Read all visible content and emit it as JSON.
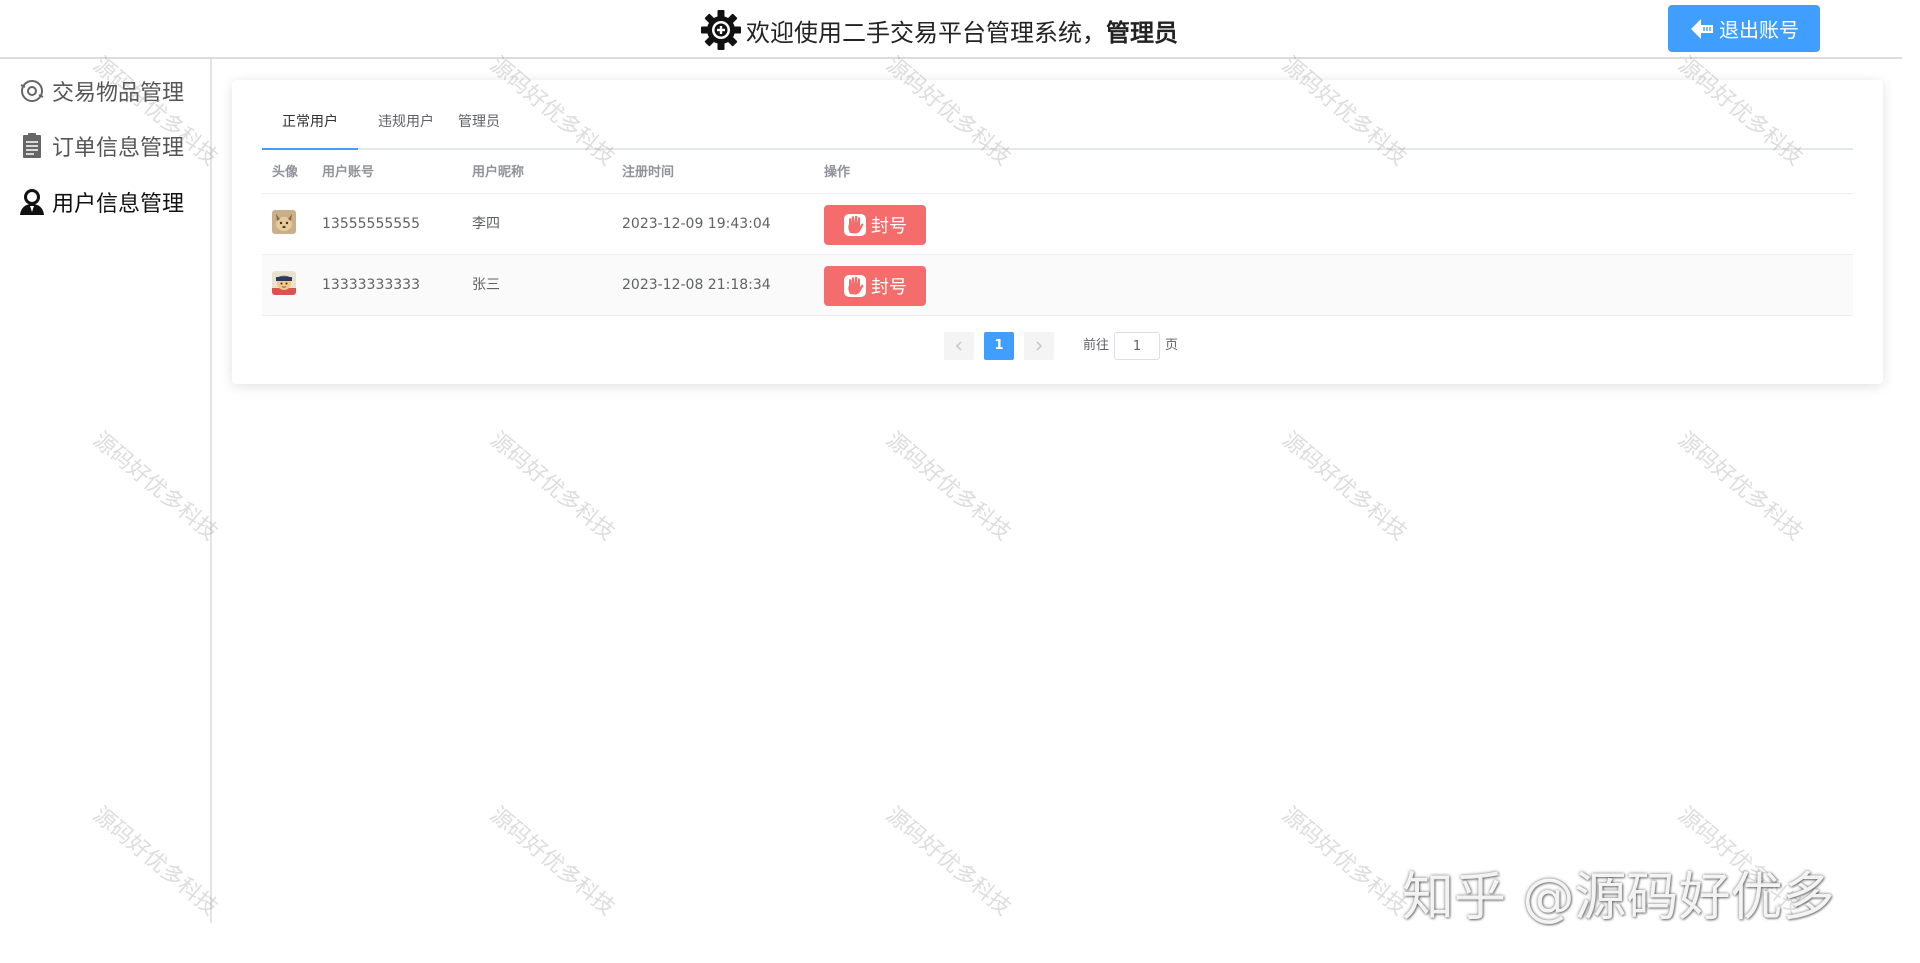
{
  "header": {
    "title": "欢迎使用二手交易平台管理系统，",
    "role": "管理员",
    "logout_label": "退出账号",
    "logout_color": "#409eff"
  },
  "sidebar": {
    "items": [
      {
        "label": "交易物品管理",
        "icon": "item-icon"
      },
      {
        "label": "订单信息管理",
        "icon": "order-icon"
      },
      {
        "label": "用户信息管理",
        "icon": "user-icon",
        "active": true
      }
    ]
  },
  "tabs": [
    {
      "label": "正常用户",
      "active": true
    },
    {
      "label": "违规用户"
    },
    {
      "label": "管理员"
    }
  ],
  "table": {
    "headers": [
      "头像",
      "用户账号",
      "用户昵称",
      "注册时间",
      "操作"
    ],
    "rows": [
      {
        "account": "13555555555",
        "nickname": "李四",
        "registered": "2023-12-09 19:43:04",
        "action": "封号"
      },
      {
        "account": "13333333333",
        "nickname": "张三",
        "registered": "2023-12-08 21:18:34",
        "action": "封号"
      }
    ],
    "ban_color": "#f56c6c"
  },
  "pagination": {
    "current_page": "1",
    "goto_prefix": "前往",
    "goto_value": "1",
    "goto_suffix": "页"
  },
  "watermark": {
    "text": "源码好优多科技",
    "brand": "知乎 @源码好优多"
  }
}
